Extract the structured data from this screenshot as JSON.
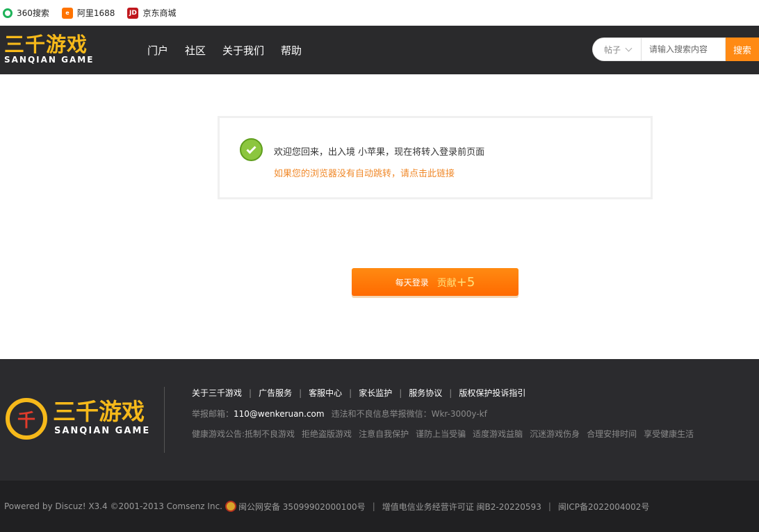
{
  "bookmarks": [
    {
      "label": "360搜索",
      "icon": "360-search-icon"
    },
    {
      "label": "阿里1688",
      "icon": "alibaba-1688-icon"
    },
    {
      "label": "京东商城",
      "icon": "jd-icon",
      "icon_text": "JD"
    }
  ],
  "header": {
    "logo_cn": "三千游戏",
    "logo_en": "SANQIAN GAME",
    "nav": [
      "门户",
      "社区",
      "关于我们",
      "帮助"
    ],
    "search": {
      "type": "帖子",
      "placeholder": "请输入搜索内容",
      "button": "搜索"
    }
  },
  "message": {
    "main": "欢迎您回来，出入境 小苹果，现在将转入登录前页面",
    "link": "如果您的浏览器没有自动跳转，请点击此链接"
  },
  "daily_login": {
    "label": "每天登录",
    "bonus": "贡献",
    "bonus_value": "+5"
  },
  "footer": {
    "logo_cn": "三千游戏",
    "logo_en": "SANQIAN GAME",
    "emblem_char": "千",
    "links": [
      "关于三千游戏",
      "广告服务",
      "客服中心",
      "家长监护",
      "服务协议",
      "版权保护投诉指引"
    ],
    "report_label": "举报邮箱：",
    "report_email": "110@wenkeruan.com",
    "report_wechat": "违法和不良信息举报微信：Wkr-3000y-kf",
    "health": [
      "健康游戏公告:抵制不良游戏",
      "拒绝盗版游戏",
      "注意自我保护",
      "谨防上当受骗",
      "适度游戏益脑",
      "沉迷游戏伤身",
      "合理安排时间",
      "享受健康生活"
    ]
  },
  "bottom": {
    "powered": "Powered by  Discuz! X3.4 ©2001-2013  Comsenz Inc.",
    "police": "闽公网安备 35099902000100号",
    "license": "增值电信业务经营许可证 闽B2-20220593",
    "icp": "闽ICP备2022004002号"
  }
}
